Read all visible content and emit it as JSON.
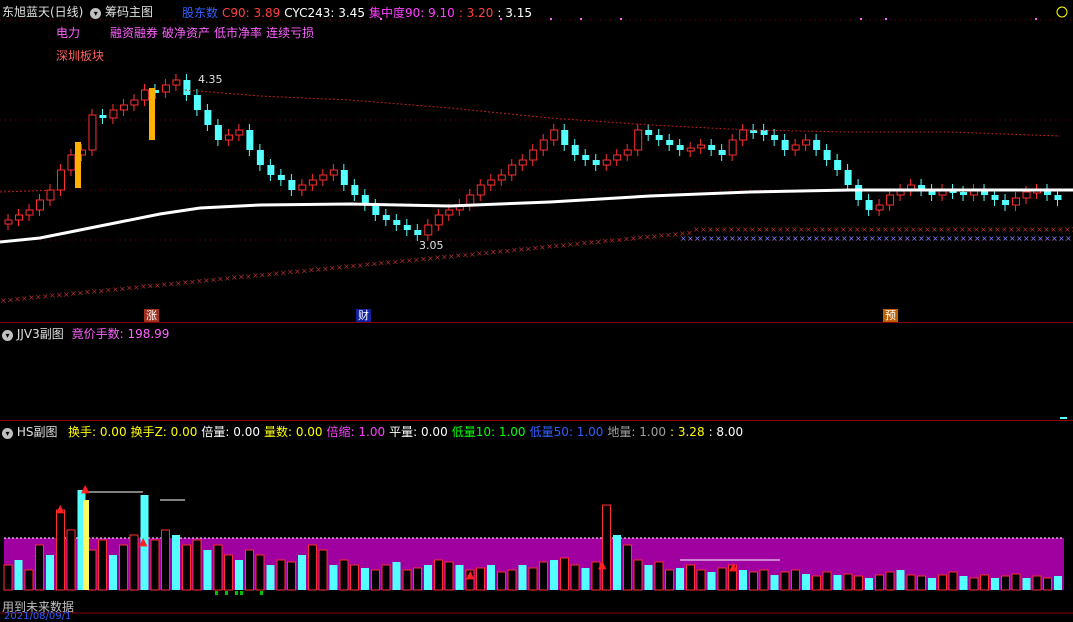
{
  "main_pane": {
    "title": "东旭蓝天(日线)",
    "indicator_name": "筹码主图",
    "fields": [
      {
        "label": "股东数",
        "color": "#3060ff"
      },
      {
        "label": "C90: 3.89",
        "color": "#ff4040"
      },
      {
        "label": "CYC243: 3.45",
        "color": "#ffffff"
      },
      {
        "label": "集中度90: 9.10",
        "color": "#ff40ff"
      },
      {
        "label": ": 3.20",
        "color": "#ff4040"
      },
      {
        "label": ": 3.15",
        "color": "#ffffff"
      }
    ],
    "concepts_row1": [
      "电力",
      "融资融券",
      "破净资产",
      "低市净率",
      "连续亏损"
    ],
    "concepts_row2": "深圳板块",
    "high_label": "4.35",
    "low_label": "3.05",
    "markers": {
      "zhang": "涨",
      "cai": "财",
      "yu": "预"
    },
    "colors": {
      "up": "#ff3030",
      "down": "#54ffff",
      "ma": "#ffffff",
      "cost": "#c02020"
    }
  },
  "jjv_pane": {
    "name": "JJV3副图",
    "field": "竟价手数: 198.99"
  },
  "hs_pane": {
    "name": "HS副图",
    "fields": [
      {
        "label": "换手: 0.00",
        "color": "#ffff00"
      },
      {
        "label": "换手Z: 0.00",
        "color": "#ffff00"
      },
      {
        "label": "倍量: 0.00",
        "color": "#ffffff"
      },
      {
        "label": "量数: 0.00",
        "color": "#ffff00"
      },
      {
        "label": "倍缩: 1.00",
        "color": "#ff40ff"
      },
      {
        "label": "平量: 0.00",
        "color": "#ffffff"
      },
      {
        "label": "低量10: 1.00",
        "color": "#00ff00"
      },
      {
        "label": "低量50: 1.00",
        "color": "#3060ff"
      },
      {
        "label": "地量: 1.00",
        "color": "#a0a0a0"
      },
      {
        "label": ": 3.28",
        "color": "#ffff00"
      },
      {
        "label": ": 8.00",
        "color": "#ffffff"
      }
    ],
    "colors": {
      "band": "#a000a0",
      "up": "#ff3030",
      "down": "#54ffff"
    }
  },
  "footer": {
    "note": "用到未来数据",
    "date": "2021/08/09/1"
  }
}
